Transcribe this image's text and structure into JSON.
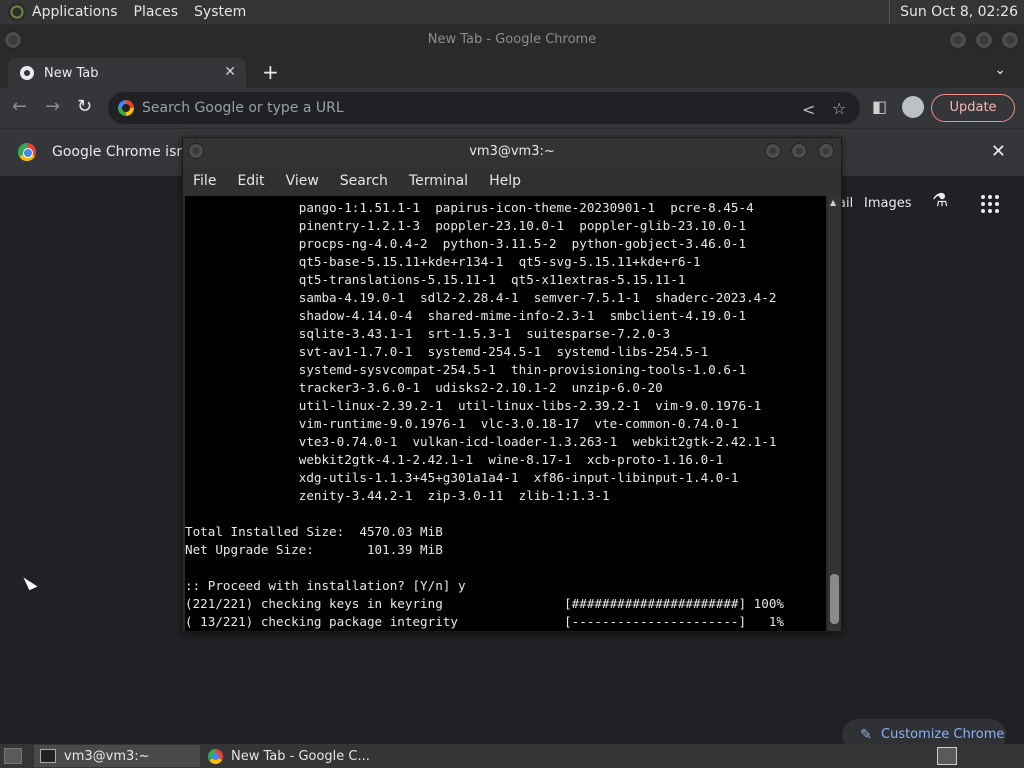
{
  "top_panel": {
    "menus": [
      "Applications",
      "Places",
      "System"
    ],
    "clock": "Sun Oct  8, 02:26"
  },
  "chrome": {
    "window_title": "New Tab - Google Chrome",
    "tab_title": "New Tab",
    "omnibox_placeholder": "Search Google or type a URL",
    "update_label": "Update",
    "infobar_text": "Google Chrome isn't",
    "gmail_fragment": "ail",
    "images_link": "Images",
    "customize_label": "Customize Chrome"
  },
  "terminal": {
    "title": "vm3@vm3:~",
    "menu": [
      "File",
      "Edit",
      "View",
      "Search",
      "Terminal",
      "Help"
    ],
    "lines": [
      "               pango-1:1.51.1-1  papirus-icon-theme-20230901-1  pcre-8.45-4",
      "               pinentry-1.2.1-3  poppler-23.10.0-1  poppler-glib-23.10.0-1",
      "               procps-ng-4.0.4-2  python-3.11.5-2  python-gobject-3.46.0-1",
      "               qt5-base-5.15.11+kde+r134-1  qt5-svg-5.15.11+kde+r6-1",
      "               qt5-translations-5.15.11-1  qt5-x11extras-5.15.11-1",
      "               samba-4.19.0-1  sdl2-2.28.4-1  semver-7.5.1-1  shaderc-2023.4-2",
      "               shadow-4.14.0-4  shared-mime-info-2.3-1  smbclient-4.19.0-1",
      "               sqlite-3.43.1-1  srt-1.5.3-1  suitesparse-7.2.0-3",
      "               svt-av1-1.7.0-1  systemd-254.5-1  systemd-libs-254.5-1",
      "               systemd-sysvcompat-254.5-1  thin-provisioning-tools-1.0.6-1",
      "               tracker3-3.6.0-1  udisks2-2.10.1-2  unzip-6.0-20",
      "               util-linux-2.39.2-1  util-linux-libs-2.39.2-1  vim-9.0.1976-1",
      "               vim-runtime-9.0.1976-1  vlc-3.0.18-17  vte-common-0.74.0-1",
      "               vte3-0.74.0-1  vulkan-icd-loader-1.3.263-1  webkit2gtk-2.42.1-1",
      "               webkit2gtk-4.1-2.42.1-1  wine-8.17-1  xcb-proto-1.16.0-1",
      "               xdg-utils-1.1.3+45+g301a1a4-1  xf86-input-libinput-1.4.0-1",
      "               zenity-3.44.2-1  zip-3.0-11  zlib-1:1.3-1",
      "",
      "Total Installed Size:  4570.03 MiB",
      "Net Upgrade Size:       101.39 MiB",
      "",
      ":: Proceed with installation? [Y/n] y",
      "(221/221) checking keys in keyring                [######################] 100%",
      "( 13/221) checking package integrity              [----------------------]   1%"
    ]
  },
  "taskbar": {
    "tasks": [
      "vm3@vm3:~",
      "New Tab - Google C..."
    ]
  }
}
